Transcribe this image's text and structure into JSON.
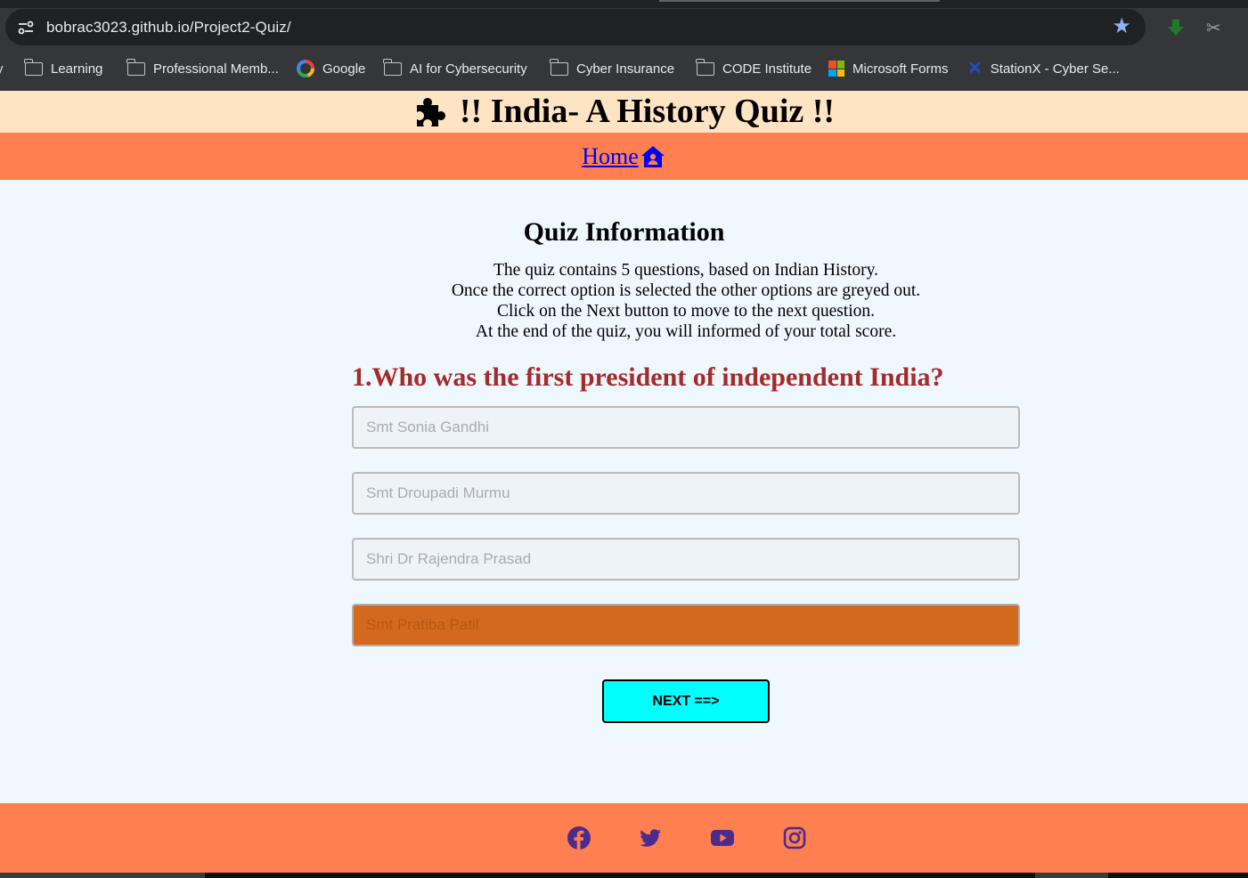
{
  "browser": {
    "url": "bobrac3023.github.io/Project2-Quiz/",
    "bookmarks": [
      {
        "label": "y",
        "icon": "folder-icon"
      },
      {
        "label": "Learning",
        "icon": "folder-icon"
      },
      {
        "label": "Professional Memb...",
        "icon": "folder-icon"
      },
      {
        "label": "Google",
        "icon": "google-icon"
      },
      {
        "label": "AI for Cybersecurity",
        "icon": "folder-icon"
      },
      {
        "label": "Cyber Insurance",
        "icon": "folder-icon"
      },
      {
        "label": "CODE Institute",
        "icon": "folder-icon"
      },
      {
        "label": "Microsoft Forms",
        "icon": "microsoft-icon"
      },
      {
        "label": "StationX - Cyber Se...",
        "icon": "stationx-icon"
      }
    ]
  },
  "header": {
    "title": "!! India- A History Quiz !!",
    "icon": "puzzle-icon",
    "nav_home": "Home",
    "nav_icon": "home-icon"
  },
  "info": {
    "title": "Quiz Information",
    "lines": [
      "The quiz contains 5 questions, based on Indian History.",
      "Once the correct option is selected the other options are greyed out.",
      "Click on the Next button to move to the next question.",
      "At the end of the quiz, you will informed of your total score."
    ]
  },
  "quiz": {
    "question": "1.Who was the first president of independent India?",
    "options": [
      "Smt Sonia Gandhi",
      "Smt Droupadi Murmu",
      "Shri Dr Rajendra Prasad",
      "Smt Pratiba Patil"
    ],
    "selected_option": "Smt Pratiba Patil",
    "next_label": "NEXT ==>"
  },
  "footer": {
    "social": [
      "facebook-icon",
      "twitter-icon",
      "youtube-icon",
      "instagram-icon"
    ]
  },
  "colors": {
    "title_bar": "#ffe4c4",
    "nav_bar": "#ff7f50",
    "page_bg": "#f0f8ff",
    "question": "#a52a2a",
    "selected_option": "#d2691e",
    "next_button": "#00ffff",
    "social_icons": "#4b2c8c"
  }
}
